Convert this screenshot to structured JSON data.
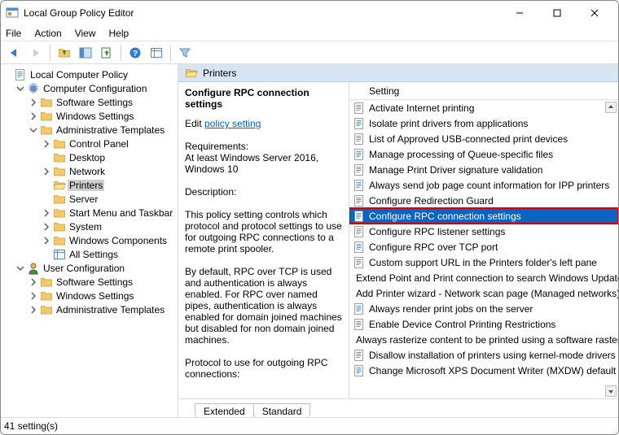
{
  "window": {
    "title": "Local Group Policy Editor"
  },
  "menu": {
    "file": "File",
    "action": "Action",
    "view": "View",
    "help": "Help"
  },
  "tree": {
    "root": "Local Computer Policy",
    "computer_config": "Computer Configuration",
    "cc_soft": "Software Settings",
    "cc_win": "Windows Settings",
    "cc_admin": "Administrative Templates",
    "at_cp": "Control Panel",
    "at_desktop": "Desktop",
    "at_network": "Network",
    "at_printers": "Printers",
    "at_server": "Server",
    "at_start": "Start Menu and Taskbar",
    "at_system": "System",
    "at_wincomp": "Windows Components",
    "at_allset": "All Settings",
    "user_config": "User Configuration",
    "uc_soft": "Software Settings",
    "uc_win": "Windows Settings",
    "uc_admin": "Administrative Templates"
  },
  "right_header": "Printers",
  "desc": {
    "title": "Configure RPC connection settings",
    "edit_label": "Edit ",
    "policy_link": "policy setting ",
    "req_label": "Requirements:",
    "req_text": "At least Windows Server 2016, Windows 10",
    "desc_label": "Description:",
    "p1": "This policy setting controls which protocol and protocol settings to use for outgoing RPC connections to a remote print spooler.",
    "p2": "By default, RPC over TCP is used and authentication is always enabled. For RPC over named pipes, authentication is always enabled for domain joined machines but disabled for non domain joined machines.",
    "p3": "Protocol to use for outgoing RPC connections:"
  },
  "list_header": "Setting",
  "settings": [
    "Activate Internet printing",
    "Isolate print drivers from applications",
    "List of Approved USB-connected print devices",
    "Manage processing of Queue-specific files",
    "Manage Print Driver signature validation",
    "Always send job page count information for IPP printers",
    "Configure Redirection Guard",
    "Configure RPC connection settings",
    "Configure RPC listener settings",
    "Configure RPC over TCP port",
    "Custom support URL in the Printers folder's left pane",
    "Extend Point and Print connection to search Windows Update",
    "Add Printer wizard - Network scan page (Managed networks)",
    "Always render print jobs on the server",
    "Enable Device Control Printing Restrictions",
    "Always rasterize content to be printed using a software rasterizer",
    "Disallow installation of printers using kernel-mode drivers",
    "Change Microsoft XPS Document Writer (MXDW) default"
  ],
  "settings_selected_index": 7,
  "tabs": {
    "extended": "Extended",
    "standard": "Standard"
  },
  "status": "41 setting(s)"
}
